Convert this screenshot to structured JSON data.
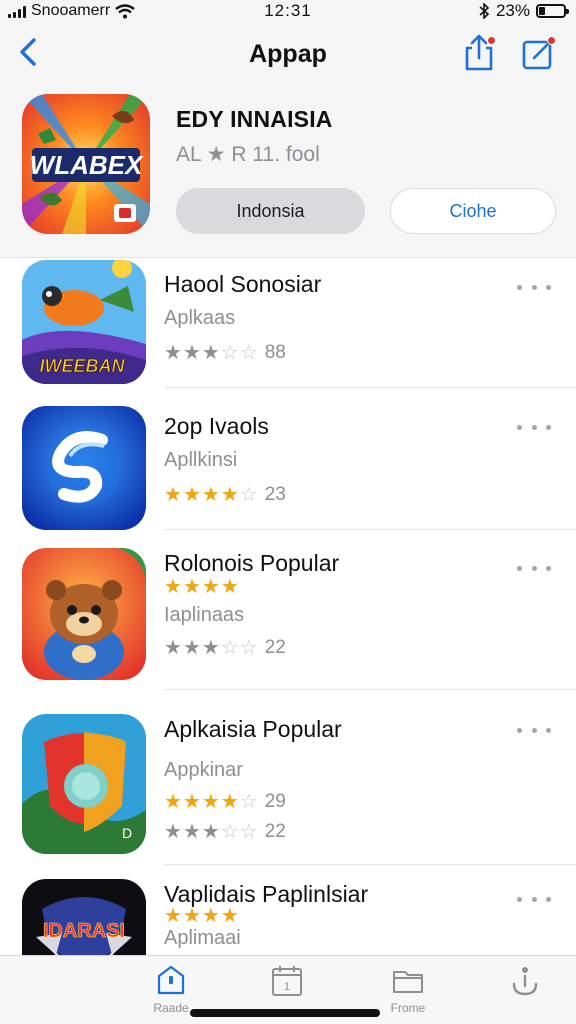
{
  "status_bar": {
    "carrier": "Snooamerr",
    "time": "12:31",
    "battery": "23%",
    "battery_level": 0.23
  },
  "nav": {
    "title": "Appap",
    "back_icon": "chevron-left-icon",
    "share_icon": "share-icon",
    "edit_icon": "compose-icon",
    "accent": "#1e6fd6",
    "badge_color": "#e5342f"
  },
  "featured": {
    "icon_text": "WLABEX",
    "title": "EDY INNAISIA",
    "subtitle": "AL ★ R 11. fool",
    "primary_button": "Indonsia",
    "secondary_button": "Ciohe"
  },
  "apps": [
    {
      "name": "Haool Sonosiar",
      "category": "Aplkaas",
      "icon_text": "IWEEBAN",
      "extra_stars": 0,
      "ratings": [
        {
          "stars": 3,
          "color": "grey",
          "count": "88"
        }
      ]
    },
    {
      "name": "2op Ivaols",
      "category": "Apllkinsi",
      "extra_stars": 0,
      "ratings": [
        {
          "stars": 4,
          "color": "gold",
          "count": "23"
        }
      ]
    },
    {
      "name": "Rolonois Popular",
      "category": "Iaplinaas",
      "extra_stars": 4,
      "ratings": [
        {
          "stars": 3,
          "color": "grey",
          "count": "22"
        }
      ]
    },
    {
      "name": "Aplkaisia Popular",
      "category": "Appkinar",
      "extra_stars": 0,
      "ratings": [
        {
          "stars": 4,
          "color": "gold",
          "count": "29"
        },
        {
          "stars": 3,
          "color": "grey",
          "count": "22"
        }
      ]
    },
    {
      "name": "Vaplidais Paplinlsiar",
      "category": "Aplimaai",
      "icon_text": "IDARASI",
      "extra_stars": 4,
      "ratings": []
    }
  ],
  "tab_bar": {
    "tabs": [
      {
        "label": "Raade",
        "icon": "home-icon"
      },
      {
        "label": "",
        "icon": "calendar-icon"
      },
      {
        "label": "Frome",
        "icon": "folder-icon"
      },
      {
        "label": "",
        "icon": "more-icon"
      }
    ]
  }
}
